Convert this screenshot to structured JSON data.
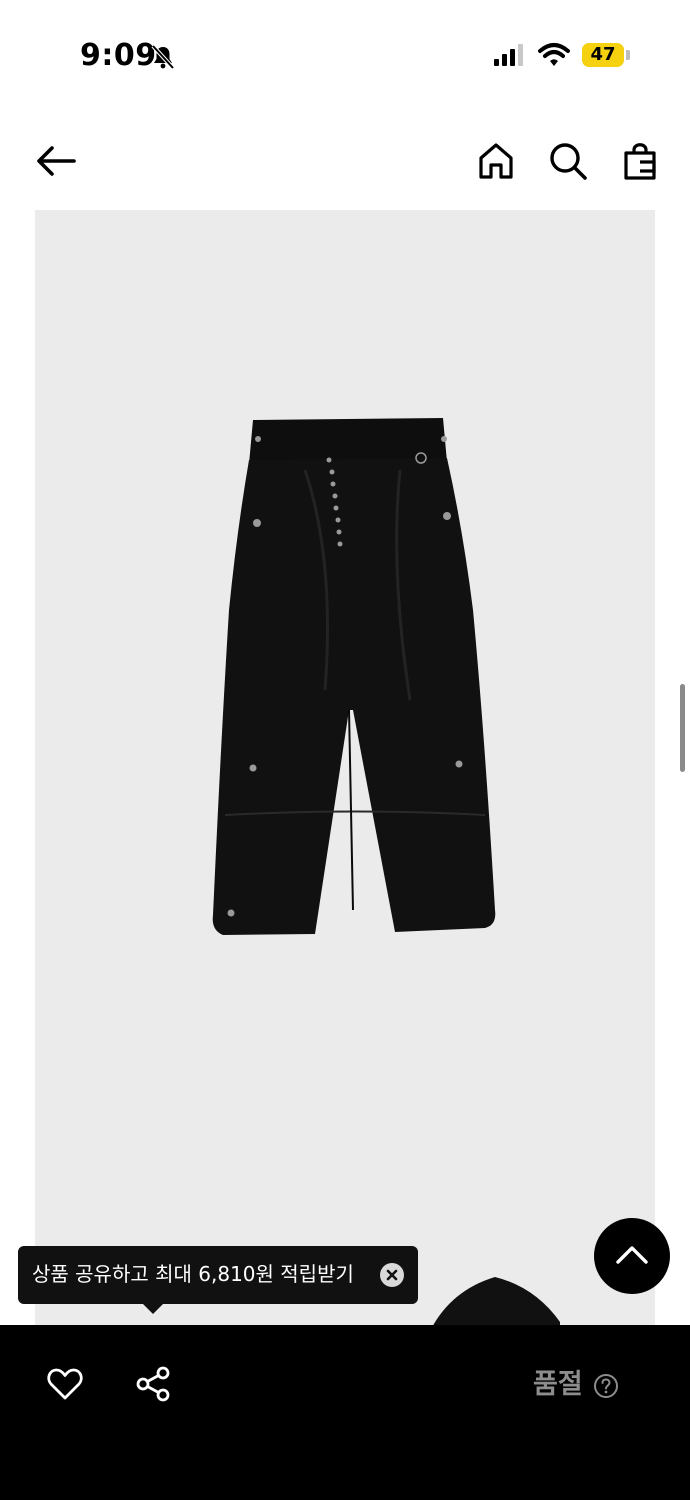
{
  "status_bar": {
    "time": "9:09",
    "battery": "47",
    "icons": [
      "bell-muted-icon",
      "signal-icon",
      "wifi-icon",
      "battery-icon"
    ]
  },
  "nav": {
    "icons": [
      "back-arrow-icon",
      "home-icon",
      "search-icon",
      "shopping-bag-icon"
    ]
  },
  "product": {
    "image": "black wide cargo pants"
  },
  "tooltip": {
    "text": "상품 공유하고 최대 6,810원 적립받기"
  },
  "bottom_bar": {
    "icons": [
      "heart-icon",
      "share-icon"
    ],
    "sold_out_label": "품절"
  },
  "colors": {
    "accent_battery": "#f5d10f",
    "bottom_bar": "#000000",
    "image_bg": "#ebebeb",
    "sold_out_text": "#8d8d8d"
  }
}
